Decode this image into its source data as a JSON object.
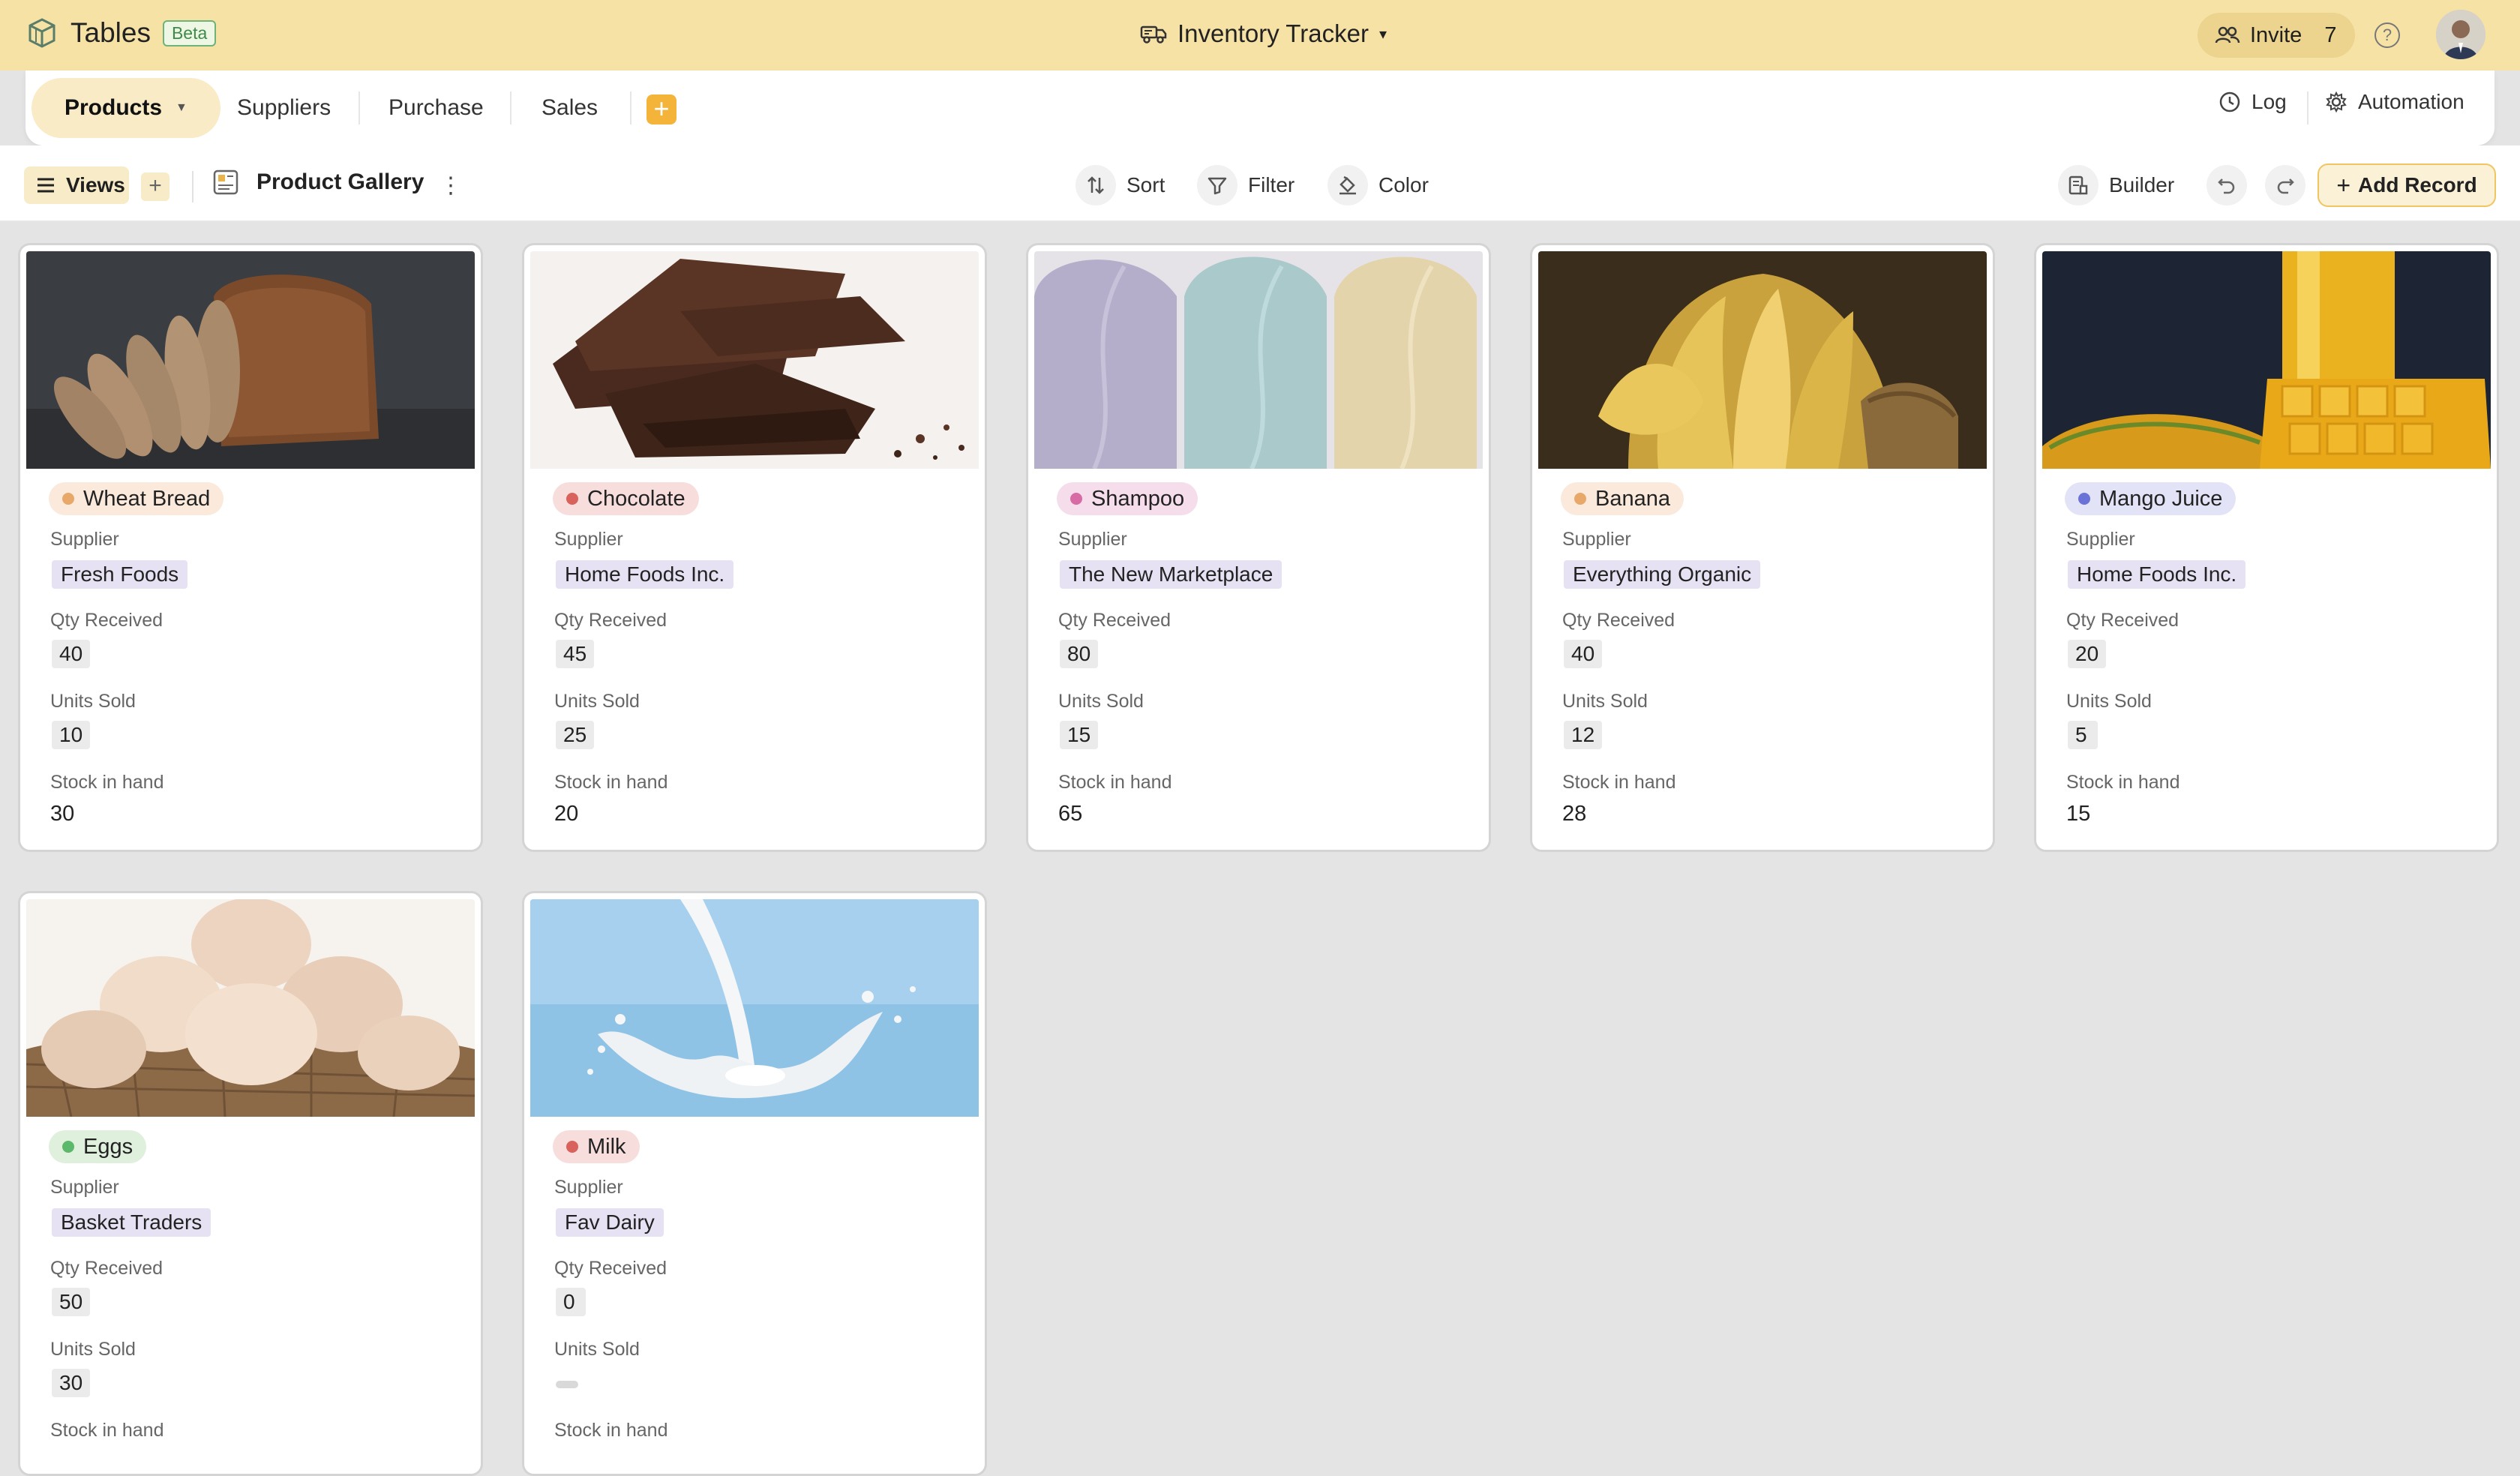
{
  "app": {
    "name": "Tables",
    "badge": "Beta"
  },
  "document": {
    "title": "Inventory Tracker"
  },
  "header": {
    "invite_label": "Invite",
    "invite_count": "7",
    "help": "?"
  },
  "tabs": [
    {
      "label": "Products"
    },
    {
      "label": "Suppliers"
    },
    {
      "label": "Purchase"
    },
    {
      "label": "Sales"
    }
  ],
  "tab_actions": {
    "log": "Log",
    "automation": "Automation"
  },
  "toolbar": {
    "views": "Views",
    "view_name": "Product Gallery",
    "sort": "Sort",
    "filter": "Filter",
    "color": "Color",
    "builder": "Builder",
    "add_record": "Add Record"
  },
  "field_labels": {
    "supplier": "Supplier",
    "qty_received": "Qty Received",
    "units_sold": "Units Sold",
    "stock": "Stock in hand"
  },
  "products": [
    {
      "name": "Wheat Bread",
      "status_color": "#e8a86a",
      "pill_bg": "#fbeadb",
      "supplier": "Fresh Foods",
      "qty_received": "40",
      "units_sold": "10",
      "stock": "30"
    },
    {
      "name": "Chocolate",
      "status_color": "#d9625c",
      "pill_bg": "#f7dedd",
      "supplier": "Home Foods Inc.",
      "qty_received": "45",
      "units_sold": "25",
      "stock": "20"
    },
    {
      "name": "Shampoo",
      "status_color": "#d86aa6",
      "pill_bg": "#f6ddec",
      "supplier": "The New Marketplace",
      "qty_received": "80",
      "units_sold": "15",
      "stock": "65"
    },
    {
      "name": "Banana",
      "status_color": "#e8a86a",
      "pill_bg": "#fbeadb",
      "supplier": "Everything Organic",
      "qty_received": "40",
      "units_sold": "12",
      "stock": "28"
    },
    {
      "name": "Mango Juice",
      "status_color": "#6a72d8",
      "pill_bg": "#e2e3f7",
      "supplier": "Home Foods Inc.",
      "qty_received": "20",
      "units_sold": "5",
      "stock": "15"
    },
    {
      "name": "Eggs",
      "status_color": "#5cb86a",
      "pill_bg": "#dff0dc",
      "supplier": "Basket Traders",
      "qty_received": "50",
      "units_sold": "30",
      "stock": ""
    },
    {
      "name": "Milk",
      "status_color": "#d9625c",
      "pill_bg": "#f7dedd",
      "supplier": "Fav Dairy",
      "qty_received": "0",
      "units_sold": "",
      "stock": ""
    }
  ]
}
